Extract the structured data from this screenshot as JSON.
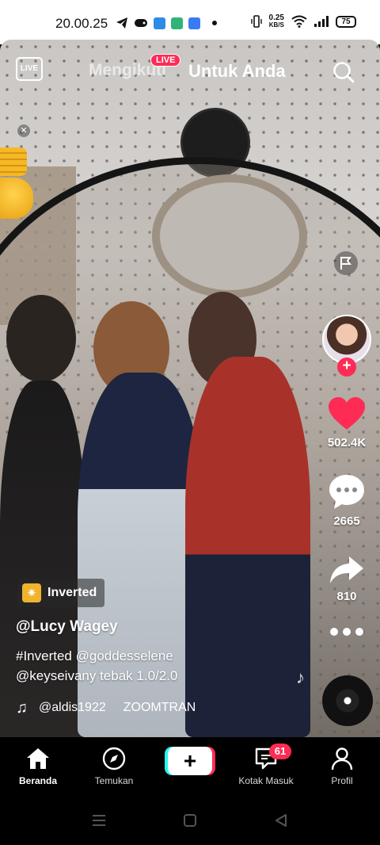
{
  "status_bar": {
    "time": "20.00.25",
    "net_speed_value": "0.25",
    "net_speed_unit": "KB/S",
    "battery": "75"
  },
  "top_nav": {
    "live_label": "LIVE",
    "following_label": "Mengikuti",
    "live_badge": "LIVE",
    "foryou_label": "Untuk Anda"
  },
  "actions": {
    "likes": "502.4K",
    "comments": "2665",
    "shares": "810"
  },
  "video": {
    "effect_label": "Inverted",
    "username": "@Lucy Wagey",
    "caption_line1": "#Inverted @goddesselene",
    "caption_line2": "@keyseivany tebak 1.0/2.0",
    "music_user": "@aldis1922",
    "music_title": "ZOOMTRAN"
  },
  "bottom_nav": {
    "items": [
      {
        "label": "Beranda"
      },
      {
        "label": "Temukan"
      },
      {
        "label": "Kotak Masuk"
      },
      {
        "label": "Profil"
      }
    ],
    "inbox_badge": "61",
    "create_symbol": "+"
  },
  "colors": {
    "accent": "#fe2c55",
    "cyan": "#25f4ee"
  }
}
